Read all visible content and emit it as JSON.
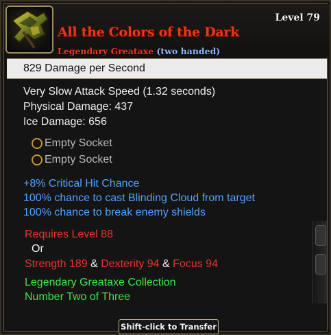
{
  "item": {
    "level_label": "Level 79",
    "name": "All the Colors of the Dark",
    "type_main": "Legendary Greataxe",
    "type_hand": "(two handed)",
    "icon": "greataxe-icon"
  },
  "dps": {
    "text": "829  Damage per Second"
  },
  "stats": {
    "attack_speed": "Very Slow Attack Speed (1.32 seconds)",
    "physical": "Physical Damage: 437",
    "ice": "Ice Damage: 656"
  },
  "sockets": [
    {
      "label": "Empty Socket"
    },
    {
      "label": "Empty Socket"
    }
  ],
  "bonuses": [
    "+8% Critical Hit Chance",
    "100% chance to cast Blinding Cloud from target",
    "100% chance to break enemy shields"
  ],
  "requirements": {
    "level": "Requires Level 88",
    "or": "Or",
    "strength": "Strength 189",
    "amp1": "&",
    "dexterity": "Dexterity 94",
    "amp2": "&",
    "focus": "Focus 94"
  },
  "collection": {
    "name": "Legendary Greataxe Collection",
    "position": "Number Two of Three"
  },
  "footer": {
    "transfer_label": "Shift-click to Transfer"
  },
  "colors": {
    "legendary_red": "#e8381c",
    "bonus_blue": "#52a2ff",
    "requirement_red": "#e8352a",
    "collection_green": "#3ee84a",
    "socket_gold": "#c79832"
  }
}
